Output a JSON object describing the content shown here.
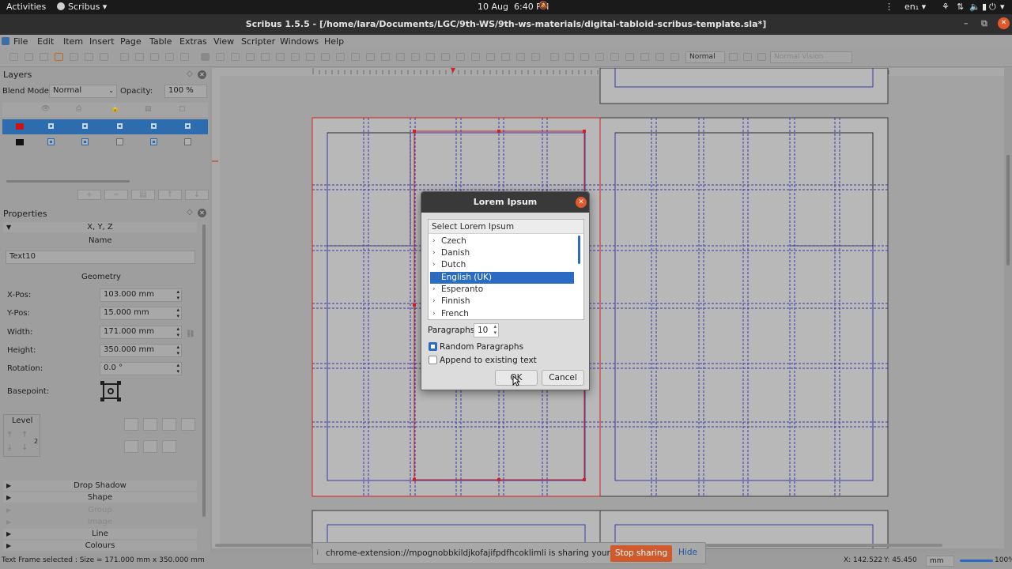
{
  "topbar": {
    "activities": "Activities",
    "app_name": "Scribus",
    "app_menu_arrow": "▾",
    "date": "10 Aug",
    "time": "6:40 PM",
    "notif_icon": "bell-off-icon",
    "overflow_icon": "⋮",
    "language": "en₁",
    "lang_arrow": "▾",
    "accessibility_icon": "⚘",
    "network_icon": "⇅",
    "volume_icon": "volume-icon",
    "battery_icon": "▮",
    "power_icon": "⏻",
    "power_arrow": "▾"
  },
  "window": {
    "title": "Scribus 1.5.5 - [/home/lara/Documents/LGC/9th-WS/9th-ws-materials/digital-tabloid-scribus-template.sla*]",
    "minimize": "–",
    "restore": "⧉",
    "close": "✕"
  },
  "menubar": [
    "File",
    "Edit",
    "Item",
    "Insert",
    "Page",
    "Table",
    "Extras",
    "View",
    "Scripter",
    "Windows",
    "Help"
  ],
  "toolbar": {
    "quality_select": "Normal",
    "view_select": "Normal Vision"
  },
  "layers": {
    "title": "Layers",
    "blend_label": "Blend Mode:",
    "blend_value": "Normal",
    "opacity_label": "Opacity:",
    "opacity_value": "100 %",
    "float_icon": "◇",
    "close": "✕",
    "rows": [
      {
        "color": "#c81414",
        "selected": true
      },
      {
        "color": "#111111",
        "selected": false
      }
    ]
  },
  "properties": {
    "title": "Properties",
    "float_icon": "◇",
    "close": "✕",
    "xyz_label": "X, Y, Z",
    "name_label": "Name",
    "name_value": "Text10",
    "geometry_label": "Geometry",
    "xpos_label": "X-Pos:",
    "xpos_value": "103.000 mm",
    "ypos_label": "Y-Pos:",
    "ypos_value": "15.000 mm",
    "width_label": "Width:",
    "width_value": "171.000 mm",
    "height_label": "Height:",
    "height_value": "350.000 mm",
    "rotation_label": "Rotation:",
    "rotation_value": "0.0 °",
    "basepoint_label": "Basepoint:",
    "level_label": "Level",
    "level_value": "2",
    "spin_arrows": "⌃⌄",
    "sections": [
      "Drop Shadow",
      "Shape",
      "Group",
      "Image",
      "Line",
      "Colours"
    ],
    "dim_sections": [
      "Group",
      "Image"
    ]
  },
  "dialog": {
    "title": "Lorem Ipsum",
    "close": "✕",
    "list_header": "Select Lorem Ipsum",
    "languages": [
      "Czech",
      "Danish",
      "Dutch",
      "English (UK)",
      "Esperanto",
      "Finnish",
      "French"
    ],
    "selected_language": "English (UK)",
    "paragraphs_label": "Paragraphs:",
    "paragraphs_value": "10",
    "random_label": "Random Paragraphs",
    "random_checked": true,
    "append_label": "Append to existing text",
    "append_checked": false,
    "ok": "OK",
    "cancel": "Cancel"
  },
  "sharebar": {
    "message": "chrome-extension://mpognobbkildjkofajifpdfhcoklimli is sharing your screen.",
    "stop": "Stop sharing",
    "hide": "Hide",
    "grip": "⁞"
  },
  "statusbar": {
    "left": "Text Frame selected : Size = 171.000 mm x 350.000 mm",
    "x": "X: 142.522",
    "y": "Y: 45.450",
    "unit": "mm",
    "zoom": "100%"
  }
}
